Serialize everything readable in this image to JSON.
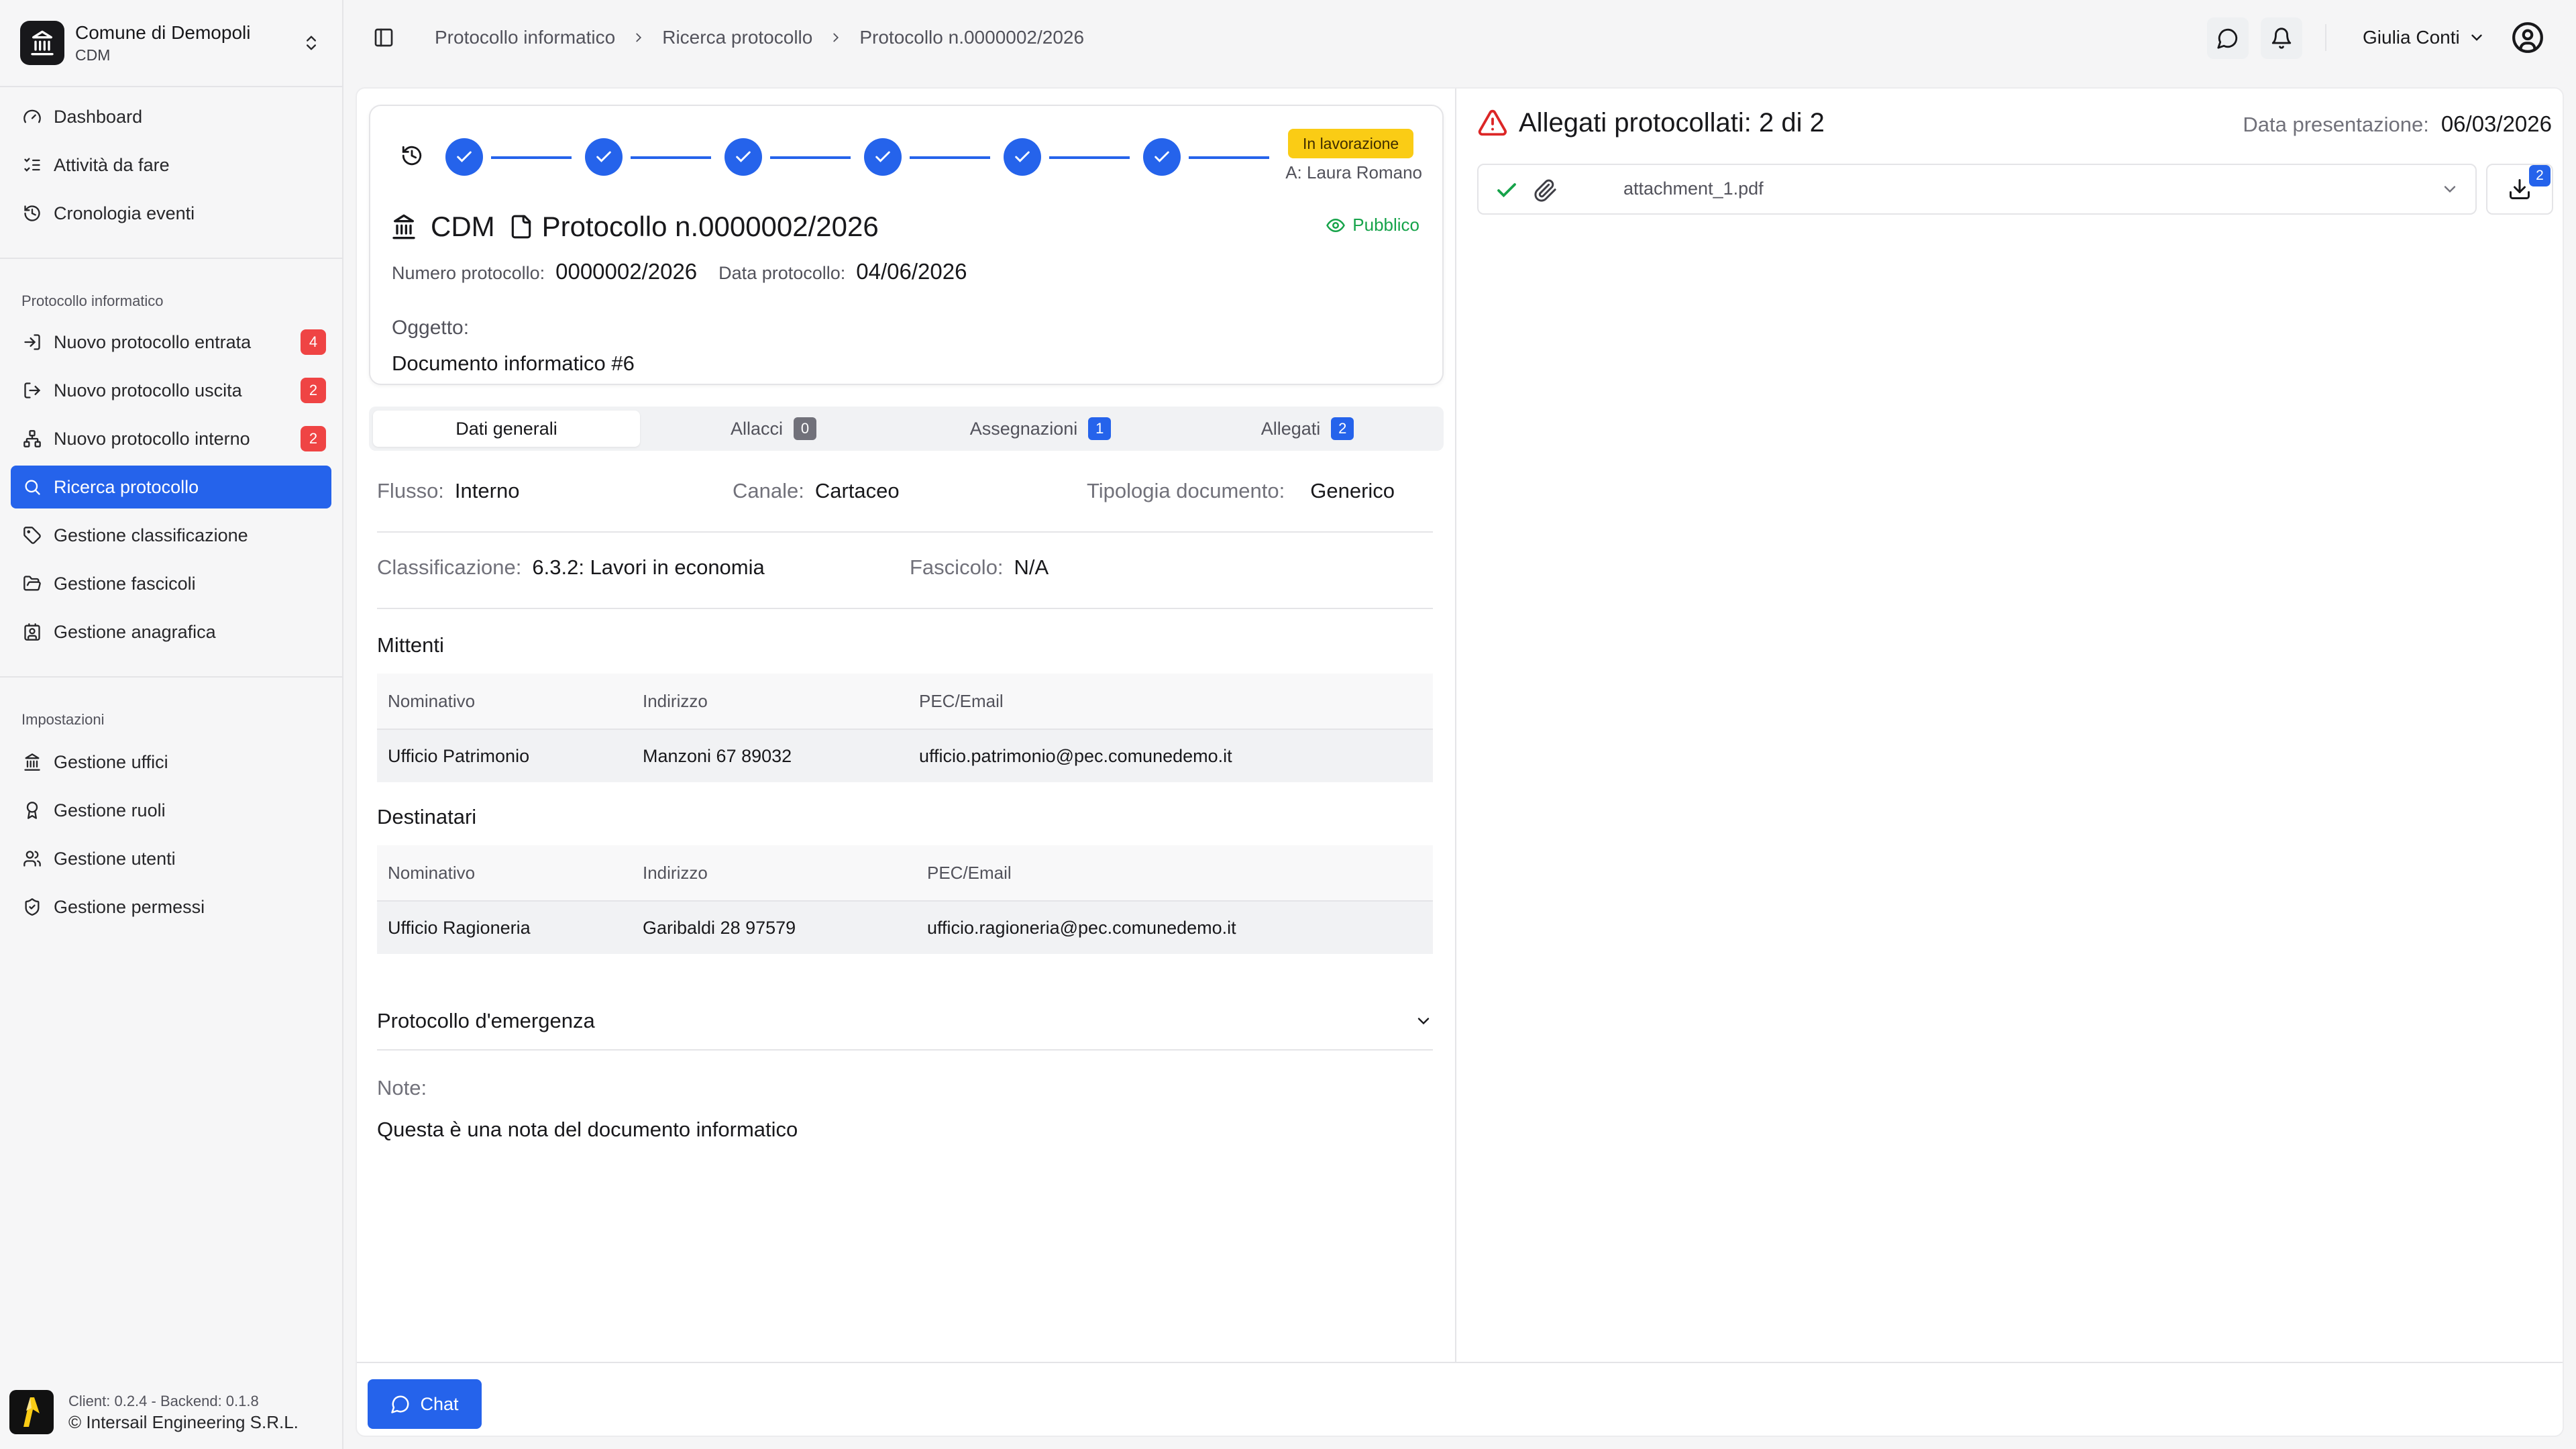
{
  "org": {
    "name": "Comune di Demopoli",
    "code": "CDM"
  },
  "nav": {
    "main": [
      {
        "label": "Dashboard",
        "icon": "gauge-icon"
      },
      {
        "label": "Attività da fare",
        "icon": "list-todo-icon"
      },
      {
        "label": "Cronologia eventi",
        "icon": "history-icon"
      }
    ],
    "protocol_section": "Protocollo informatico",
    "protocol": [
      {
        "label": "Nuovo protocollo entrata",
        "icon": "log-in-icon",
        "badge": "4"
      },
      {
        "label": "Nuovo protocollo uscita",
        "icon": "log-out-icon",
        "badge": "2"
      },
      {
        "label": "Nuovo protocollo interno",
        "icon": "network-icon",
        "badge": "2"
      },
      {
        "label": "Ricerca protocollo",
        "icon": "search-icon",
        "active": true
      },
      {
        "label": "Gestione classificazione",
        "icon": "tag-icon"
      },
      {
        "label": "Gestione fascicoli",
        "icon": "folder-open-icon"
      },
      {
        "label": "Gestione anagrafica",
        "icon": "contact-icon"
      }
    ],
    "settings_section": "Impostazioni",
    "settings": [
      {
        "label": "Gestione uffici",
        "icon": "landmark-icon"
      },
      {
        "label": "Gestione ruoli",
        "icon": "award-icon"
      },
      {
        "label": "Gestione utenti",
        "icon": "users-icon"
      },
      {
        "label": "Gestione permessi",
        "icon": "shield-check-icon"
      }
    ]
  },
  "footer": {
    "version": "Client: 0.2.4 - Backend: 0.1.8",
    "copyright": "© Intersail Engineering S.R.L."
  },
  "header": {
    "breadcrumbs": [
      "Protocollo informatico",
      "Ricerca protocollo",
      "Protocollo n.0000002/2026"
    ],
    "user_name": "Giulia Conti"
  },
  "protocol": {
    "status": "In lavorazione",
    "assignee": "A: Laura Romano",
    "office": "CDM",
    "title": "Protocollo n.0000002/2026",
    "visibility": "Pubblico",
    "numero_label": "Numero protocollo:",
    "numero": "0000002/2026",
    "data_label": "Data protocollo:",
    "data": "04/06/2026",
    "oggetto_label": "Oggetto:",
    "oggetto": "Documento informatico #6",
    "steps_completed": 6
  },
  "tabs": [
    {
      "label": "Dati generali",
      "active": true
    },
    {
      "label": "Allacci",
      "badge": "0",
      "badge_color": "#71717a"
    },
    {
      "label": "Assegnazioni",
      "badge": "1",
      "badge_color": "#2563eb"
    },
    {
      "label": "Allegati",
      "badge": "2",
      "badge_color": "#2563eb"
    }
  ],
  "details": {
    "flusso_label": "Flusso:",
    "flusso": "Interno",
    "canale_label": "Canale:",
    "canale": "Cartaceo",
    "tipologia_label": "Tipologia documento:",
    "tipologia": "Generico",
    "classificazione_label": "Classificazione:",
    "classificazione": "6.3.2: Lavori in economia",
    "fascicolo_label": "Fascicolo:",
    "fascicolo": "N/A"
  },
  "mittenti": {
    "title": "Mittenti",
    "columns": [
      "Nominativo",
      "Indirizzo",
      "PEC/Email"
    ],
    "rows": [
      [
        "Ufficio Patrimonio",
        "Manzoni 67 89032",
        "ufficio.patrimonio@pec.comunedemo.it"
      ]
    ]
  },
  "destinatari": {
    "title": "Destinatari",
    "columns": [
      "Nominativo",
      "Indirizzo",
      "PEC/Email"
    ],
    "rows": [
      [
        "Ufficio Ragioneria",
        "Garibaldi 28 97579",
        "ufficio.ragioneria@pec.comunedemo.it"
      ]
    ]
  },
  "emergency": {
    "label": "Protocollo d'emergenza"
  },
  "note": {
    "label": "Note:",
    "text": "Questa è una nota del documento informatico"
  },
  "chat": {
    "label": "Chat"
  },
  "attachments": {
    "title": "Allegati protocollati: 2 di 2",
    "date_label": "Data presentazione:",
    "date": "06/03/2026",
    "selected_file": "attachment_1.pdf",
    "download_badge": "2"
  },
  "colors": {
    "accent": "#2563eb",
    "danger": "#ef4444",
    "warning": "#facc15",
    "success": "#16a34a"
  }
}
